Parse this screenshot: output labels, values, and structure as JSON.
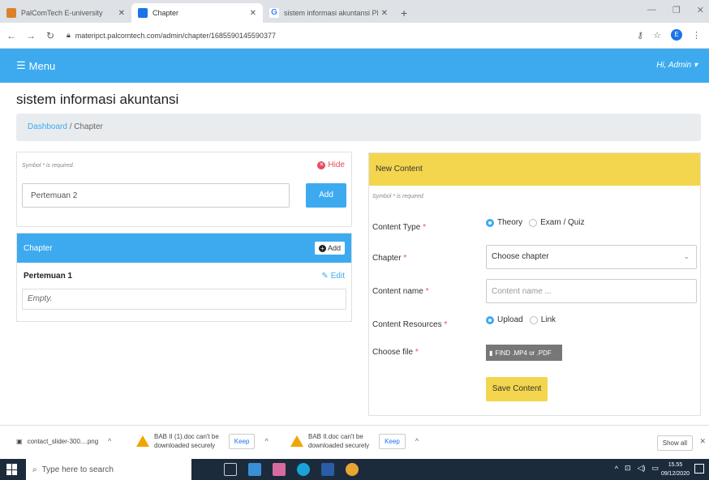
{
  "browser": {
    "tabs": [
      {
        "title": "PalComTech E-university",
        "active": false
      },
      {
        "title": "Chapter",
        "active": true
      },
      {
        "title": "sistem informasi akuntansi PNG",
        "active": false
      }
    ],
    "url": "materipct.palcomtech.com/admin/chapter/1685590145590377"
  },
  "appbar": {
    "menu_label": "Menu",
    "user_label": "Hi, Admin"
  },
  "page": {
    "title": "sistem informasi akuntansi",
    "breadcrumb": {
      "home": "Dashboard",
      "separator": "/",
      "current": "Chapter"
    }
  },
  "chapter_form": {
    "required_note": "Symbol * is required.",
    "hide_label": "Hide",
    "input_value": "Pertemuan 2",
    "add_label": "Add"
  },
  "chapter_panel": {
    "title": "Chapter",
    "add_label": "Add",
    "items": [
      {
        "name": "Pertemuan 1",
        "edit_label": "Edit",
        "content": "Empty."
      }
    ]
  },
  "content_form": {
    "title": "New Content",
    "required_note": "Symbol * is required.",
    "content_type_label": "Content Type",
    "content_type_options": [
      "Theory",
      "Exam / Quiz"
    ],
    "content_type_selected": "Theory",
    "chapter_label": "Chapter",
    "chapter_select": "Choose chapter",
    "name_label": "Content name",
    "name_placeholder": "Content name ...",
    "resources_label": "Content Resources",
    "resources_options": [
      "Upload",
      "Link"
    ],
    "resources_selected": "Upload",
    "file_label": "Choose file",
    "find_label": "FIND .MP4 or .PDF",
    "save_label": "Save Content",
    "required_star": "*"
  },
  "downloads": {
    "items": [
      {
        "name": "contact_slider-300....png"
      },
      {
        "line1": "BAB II (1).doc can't be",
        "line2": "downloaded securely",
        "keep": "Keep"
      },
      {
        "line1": "BAB II.doc can't be",
        "line2": "downloaded securely",
        "keep": "Keep"
      }
    ],
    "show_all": "Show all"
  },
  "taskbar": {
    "search_placeholder": "Type here to search",
    "time": "15.55",
    "date": "09/12/2020"
  },
  "colors": {
    "accent": "#3daaf0",
    "warning": "#f3d64e",
    "danger": "#e84a5f"
  }
}
